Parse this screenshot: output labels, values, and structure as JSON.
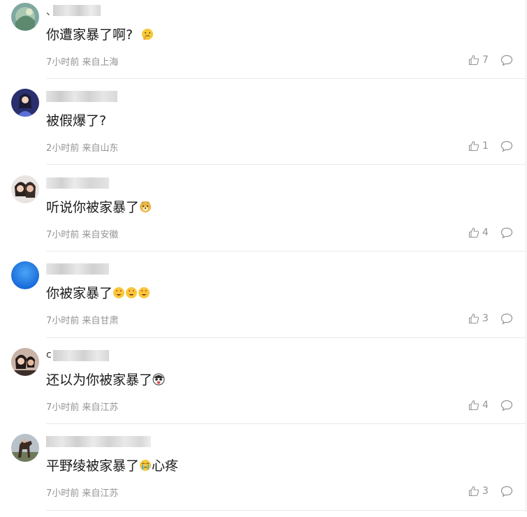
{
  "comments": [
    {
      "username_prefix": "、",
      "text": "你遭家暴了啊?",
      "emoji": "thinking-face-emoji",
      "meta": "7小时前 来自上海",
      "likes": "7"
    },
    {
      "username_prefix": "",
      "text": "被假爆了?",
      "meta": "2小时前 来自山东",
      "likes": "1"
    },
    {
      "username_prefix": "",
      "text": "听说你被家暴了",
      "emoji": "doge-emoji",
      "meta": "7小时前 来自安徽",
      "likes": "4"
    },
    {
      "username_prefix": "",
      "text": "你被家暴了",
      "emoji": "heart-eyes-emoji",
      "meta": "7小时前 来自甘肃",
      "likes": "3"
    },
    {
      "username_prefix": "c",
      "text": "还以为你被家暴了",
      "emoji": "shocked-face-emoji",
      "meta": "7小时前 来自江苏",
      "likes": "4"
    },
    {
      "username_prefix": "",
      "text": "平野绫被家暴了",
      "text_suffix": "心疼",
      "emoji": "crying-face-emoji",
      "meta": "7小时前 来自江苏",
      "likes": "3"
    }
  ],
  "icons": {
    "like": "thumbs-up-icon",
    "reply": "comment-bubble-icon"
  },
  "colors": {
    "meta_text": "#939393",
    "divider": "#e9e9e9",
    "content_text": "#1a1a1a",
    "emoji_yellow": "#f7c83a"
  }
}
